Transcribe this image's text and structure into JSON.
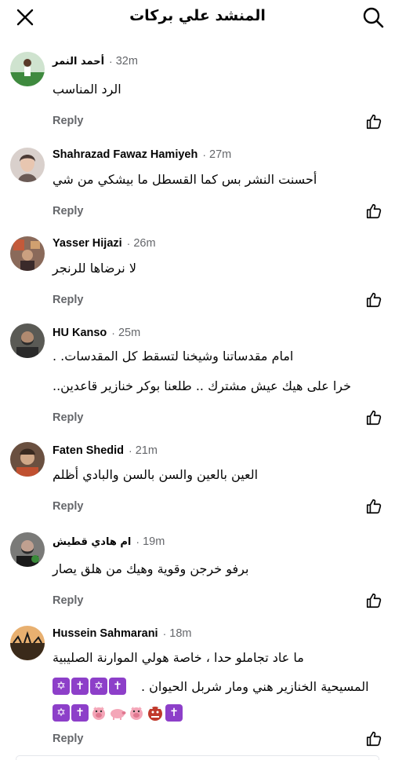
{
  "header": {
    "title": "المنشد علي بركات"
  },
  "comments": [
    {
      "author": "أحمد النمر",
      "time": "32m",
      "lines": [
        "الرد المناسب"
      ],
      "reply_label": "Reply",
      "avatar_color": "#3a6b3a"
    },
    {
      "author": "Shahrazad Fawaz Hamiyeh",
      "time": "27m",
      "lines": [
        "أحسنت النشر بس كما القسطل ما بيشكي من شي"
      ],
      "reply_label": "Reply",
      "avatar_color": "#b8a39a"
    },
    {
      "author": "Yasser Hijazi",
      "time": "26m",
      "lines": [
        "لا نرضاها للرنجر"
      ],
      "reply_label": "Reply",
      "avatar_color": "#6b4a3a"
    },
    {
      "author": "HU Kanso",
      "time": "25m",
      "lines": [
        "امام مقدساتنا وشيخنا لتسقط كل المقدسات. .",
        "خرا على هيك عيش مشترك .. طلعنا بوكر خنازير قاعدين.."
      ],
      "reply_label": "Reply",
      "avatar_color": "#4a4a4a"
    },
    {
      "author": "Faten Shedid",
      "time": "21m",
      "lines": [
        "العين بالعين والسن بالسن والبادي أظلم"
      ],
      "reply_label": "Reply",
      "avatar_color": "#8a6a4a"
    },
    {
      "author": "ام هادي قطيش",
      "time": "19m",
      "lines": [
        "برفو خرجن وقوية وهيك من هلق يصار"
      ],
      "reply_label": "Reply",
      "avatar_color": "#3a3a3a"
    },
    {
      "author": "Hussein Sahmarani",
      "time": "18m",
      "lines": [
        "ما عاد تجاملو حدا ، خاصة هولي الموارنة الصليبية",
        "المسيحية الخنازير هني ومار شربل الحيوان ."
      ],
      "emoji_row_1": [
        "✡",
        "✝",
        "✡",
        "✝"
      ],
      "emoji_row_2": [
        "✡",
        "✝",
        "🐖",
        "🐖",
        "🐖",
        "👹",
        "✝"
      ],
      "reply_label": "Reply",
      "avatar_color": "#a08060"
    }
  ],
  "colors": {
    "secondary_text": "#65676b",
    "primary_text": "#050505",
    "emoji_purple": "#8d3fc9"
  }
}
